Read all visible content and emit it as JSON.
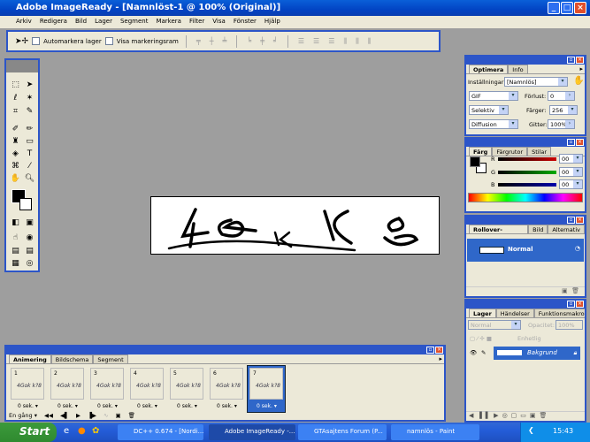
{
  "window": {
    "title": "Adobe ImageReady - [Namnlöst-1 @ 100% (Original)]",
    "minimize": "_",
    "maximize": "□",
    "close": "×"
  },
  "menu": [
    "Arkiv",
    "Redigera",
    "Bild",
    "Lager",
    "Segment",
    "Markera",
    "Filter",
    "Visa",
    "Fönster",
    "Hjälp"
  ],
  "options": {
    "auto_select": "Automarkera lager",
    "show_bounds": "Visa markeringsram"
  },
  "optimize": {
    "tabs": [
      "Optimera",
      "Info"
    ],
    "settings_label": "Inställningar:",
    "settings_value": "[Namnlös]",
    "format": "GIF",
    "lossy_label": "Förlust:",
    "lossy_value": "0",
    "palette": "Selektiv",
    "colors_label": "Färger:",
    "colors_value": "256",
    "dither": "Diffusion",
    "dither_label": "Gitter:",
    "dither_value": "100%"
  },
  "color": {
    "tabs": [
      "Färg",
      "Färgrutor",
      "Stilar"
    ],
    "channels": [
      {
        "name": "R",
        "value": "00",
        "color": "#cc0000"
      },
      {
        "name": "G",
        "value": "00",
        "color": "#00aa00"
      },
      {
        "name": "B",
        "value": "00",
        "color": "#0000aa"
      }
    ],
    "foreground": "#000000",
    "background": "#ffffff"
  },
  "rollover": {
    "tabs": [
      "Rollover-symboler",
      "Bild",
      "Alternativ"
    ],
    "state": "Normal"
  },
  "layers": {
    "tabs": [
      "Lager",
      "Händelser",
      "Funktionsmakron"
    ],
    "blend": "Normal",
    "opacity_label": "Opacitet:",
    "opacity": "100%",
    "lock_label": "Enhetlig",
    "layer_name": "Bakgrund"
  },
  "animation": {
    "tabs": [
      "Animering",
      "Bildschema",
      "Segment"
    ],
    "frames": [
      {
        "n": "1",
        "delay": "0 sek."
      },
      {
        "n": "2",
        "delay": "0 sek."
      },
      {
        "n": "3",
        "delay": "0 sek."
      },
      {
        "n": "4",
        "delay": "0 sek."
      },
      {
        "n": "5",
        "delay": "0 sek."
      },
      {
        "n": "6",
        "delay": "0 sek."
      },
      {
        "n": "7",
        "delay": "0 sek."
      }
    ],
    "selected_frame": 7,
    "loop": "En gång"
  },
  "taskbar": {
    "start": "Start",
    "tasks": [
      "DC++ 0.674 - [Nordi...",
      "Adobe ImageReady -...",
      "GTAsajtens Forum (P...",
      "namnlös - Paint"
    ],
    "active_task": 1,
    "clock": "15:43"
  }
}
